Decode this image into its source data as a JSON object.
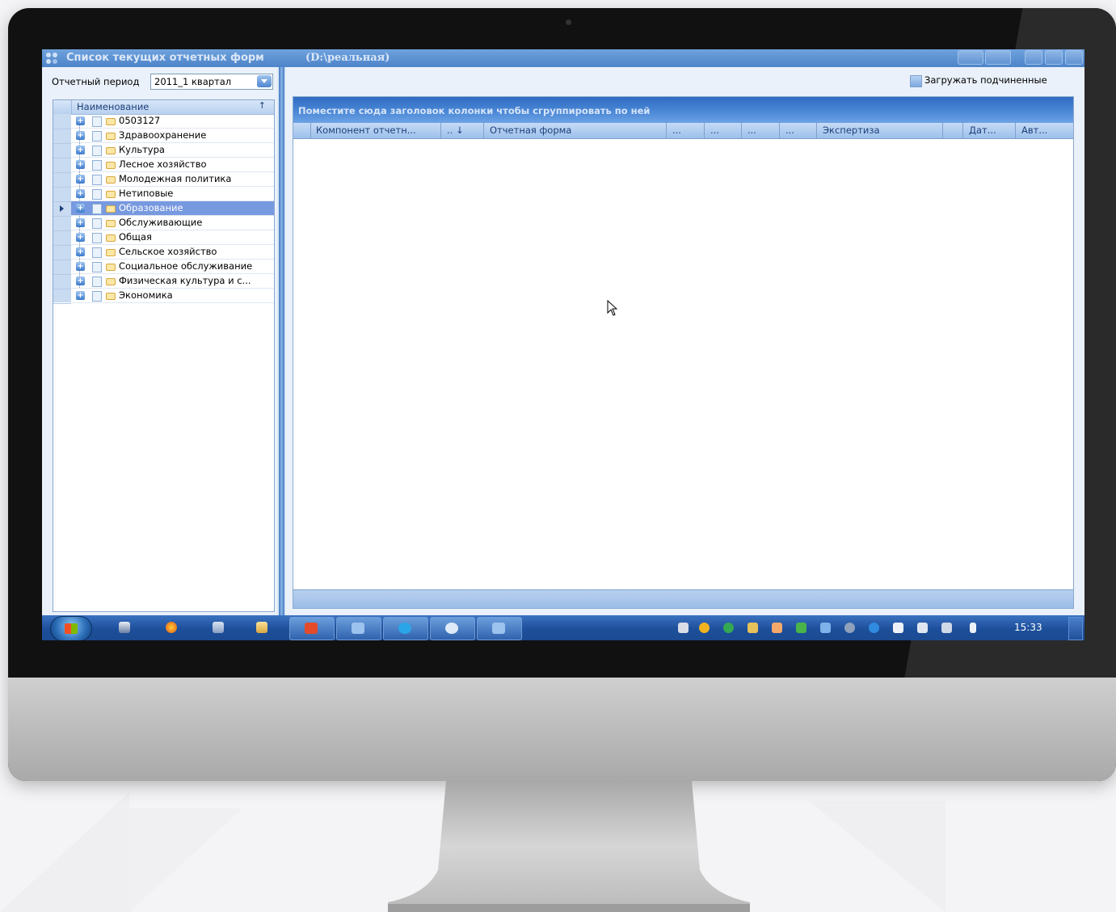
{
  "window": {
    "title": "Список текущих отчетных форм",
    "path": "(D:\\реальная)"
  },
  "left": {
    "period_label": "Отчетный период",
    "period_value": "2011_1 квартал",
    "tree_header": "Наименование",
    "tree_sort_glyph": "↑",
    "items": [
      {
        "label": "0503127"
      },
      {
        "label": "Здравоохранение"
      },
      {
        "label": "Культура"
      },
      {
        "label": "Лесное хозяйство"
      },
      {
        "label": "Молодежная политика"
      },
      {
        "label": "Нетиповые"
      },
      {
        "label": "Образование",
        "selected": true
      },
      {
        "label": "Обслуживающие"
      },
      {
        "label": "Общая"
      },
      {
        "label": "Сельское хозяйство"
      },
      {
        "label": "Социальное обслуживание"
      },
      {
        "label": "Физическая культура и с..."
      },
      {
        "label": "Экономика"
      }
    ]
  },
  "right": {
    "load_subordinates_label": "Загружать подчиненные",
    "group_hint": "Поместите сюда заголовок колонки чтобы сгруппировать по ней",
    "columns": [
      {
        "label": "Компонент отчетн..."
      },
      {
        "label": ".. ↓"
      },
      {
        "label": "Отчетная форма"
      },
      {
        "label": "..."
      },
      {
        "label": "..."
      },
      {
        "label": "..."
      },
      {
        "label": "..."
      },
      {
        "label": "Экспертиза"
      },
      {
        "label": ""
      },
      {
        "label": "Дат..."
      },
      {
        "label": "Авт..."
      }
    ]
  },
  "taskbar": {
    "clock": "15:33",
    "quick_launch": [
      "floppy-icon",
      "firefox-icon",
      "calculator-icon",
      "folder-icon"
    ],
    "buttons": [
      "pdf-viewer-icon",
      "report-app-icon",
      "skype-icon",
      "power-icon",
      "report-app-icon"
    ],
    "tray": [
      "pen-icon",
      "antivirus-icon",
      "sync-icon",
      "key-icon",
      "chat-icon",
      "network-agent-icon",
      "network-icon",
      "media-icon",
      "browser-icon",
      "flag-icon",
      "devices-icon",
      "monitor-icon",
      "volume-icon"
    ]
  },
  "colors": {
    "titlebar": "#4d84c9",
    "selection": "#7799e0",
    "group_bar": "#2f6bc1",
    "taskbar": "#1d4f9b"
  }
}
